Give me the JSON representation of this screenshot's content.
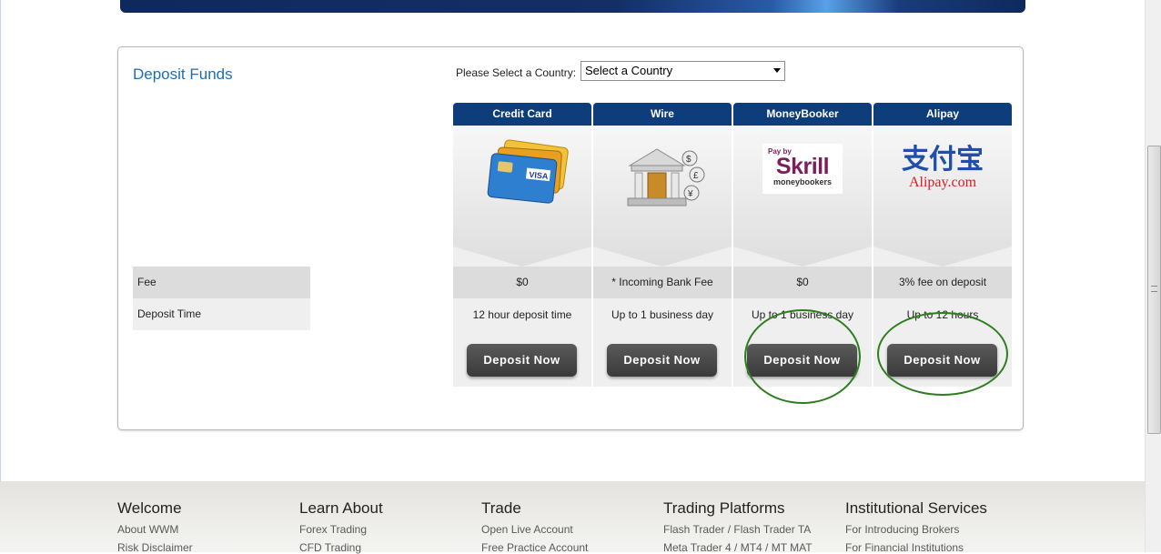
{
  "panel": {
    "title": "Deposit Funds",
    "country_label": "Please Select a Country:",
    "country_select": "Select a Country"
  },
  "rows": {
    "fee_label": "Fee",
    "time_label": "Deposit Time"
  },
  "methods": [
    {
      "name": "Credit Card",
      "fee": "$0",
      "time": "12 hour deposit time",
      "button": "Deposit Now",
      "icon": "credit-card-icon"
    },
    {
      "name": "Wire",
      "fee": "* Incoming Bank Fee",
      "time": "Up to 1 business day",
      "button": "Deposit Now",
      "icon": "bank-icon"
    },
    {
      "name": "MoneyBooker",
      "fee": "$0",
      "time": "Up to 1 business day",
      "button": "Deposit Now",
      "icon": "skrill-logo"
    },
    {
      "name": "Alipay",
      "fee": "3% fee on deposit",
      "time": "Up to 12 hours",
      "button": "Deposit Now",
      "icon": "alipay-logo"
    }
  ],
  "logos": {
    "skrill_top": "Pay by",
    "skrill_main": "Skrill",
    "skrill_sub": "moneybookers",
    "alipay_cn": "支付宝",
    "alipay_en": "Alipay.com",
    "visa": "VISA"
  },
  "footer": [
    {
      "heading": "Welcome",
      "links": [
        "About WWM",
        "Risk Disclaimer"
      ]
    },
    {
      "heading": "Learn About",
      "links": [
        "Forex Trading",
        "CFD Trading"
      ]
    },
    {
      "heading": "Trade",
      "links": [
        "Open Live Account",
        "Free Practice Account"
      ]
    },
    {
      "heading": "Trading Platforms",
      "links": [
        "Flash Trader / Flash Trader TA",
        "Meta Trader 4 / MT4 / MT MAT"
      ]
    },
    {
      "heading": "Institutional Services",
      "links": [
        "For Introducing Brokers",
        "For Financial Institutions"
      ]
    }
  ],
  "colors": {
    "header_blue": "#0d3d7a",
    "title_blue": "#1a6fba",
    "button_dark": "#454545",
    "highlight_green": "#2e7d1e"
  }
}
